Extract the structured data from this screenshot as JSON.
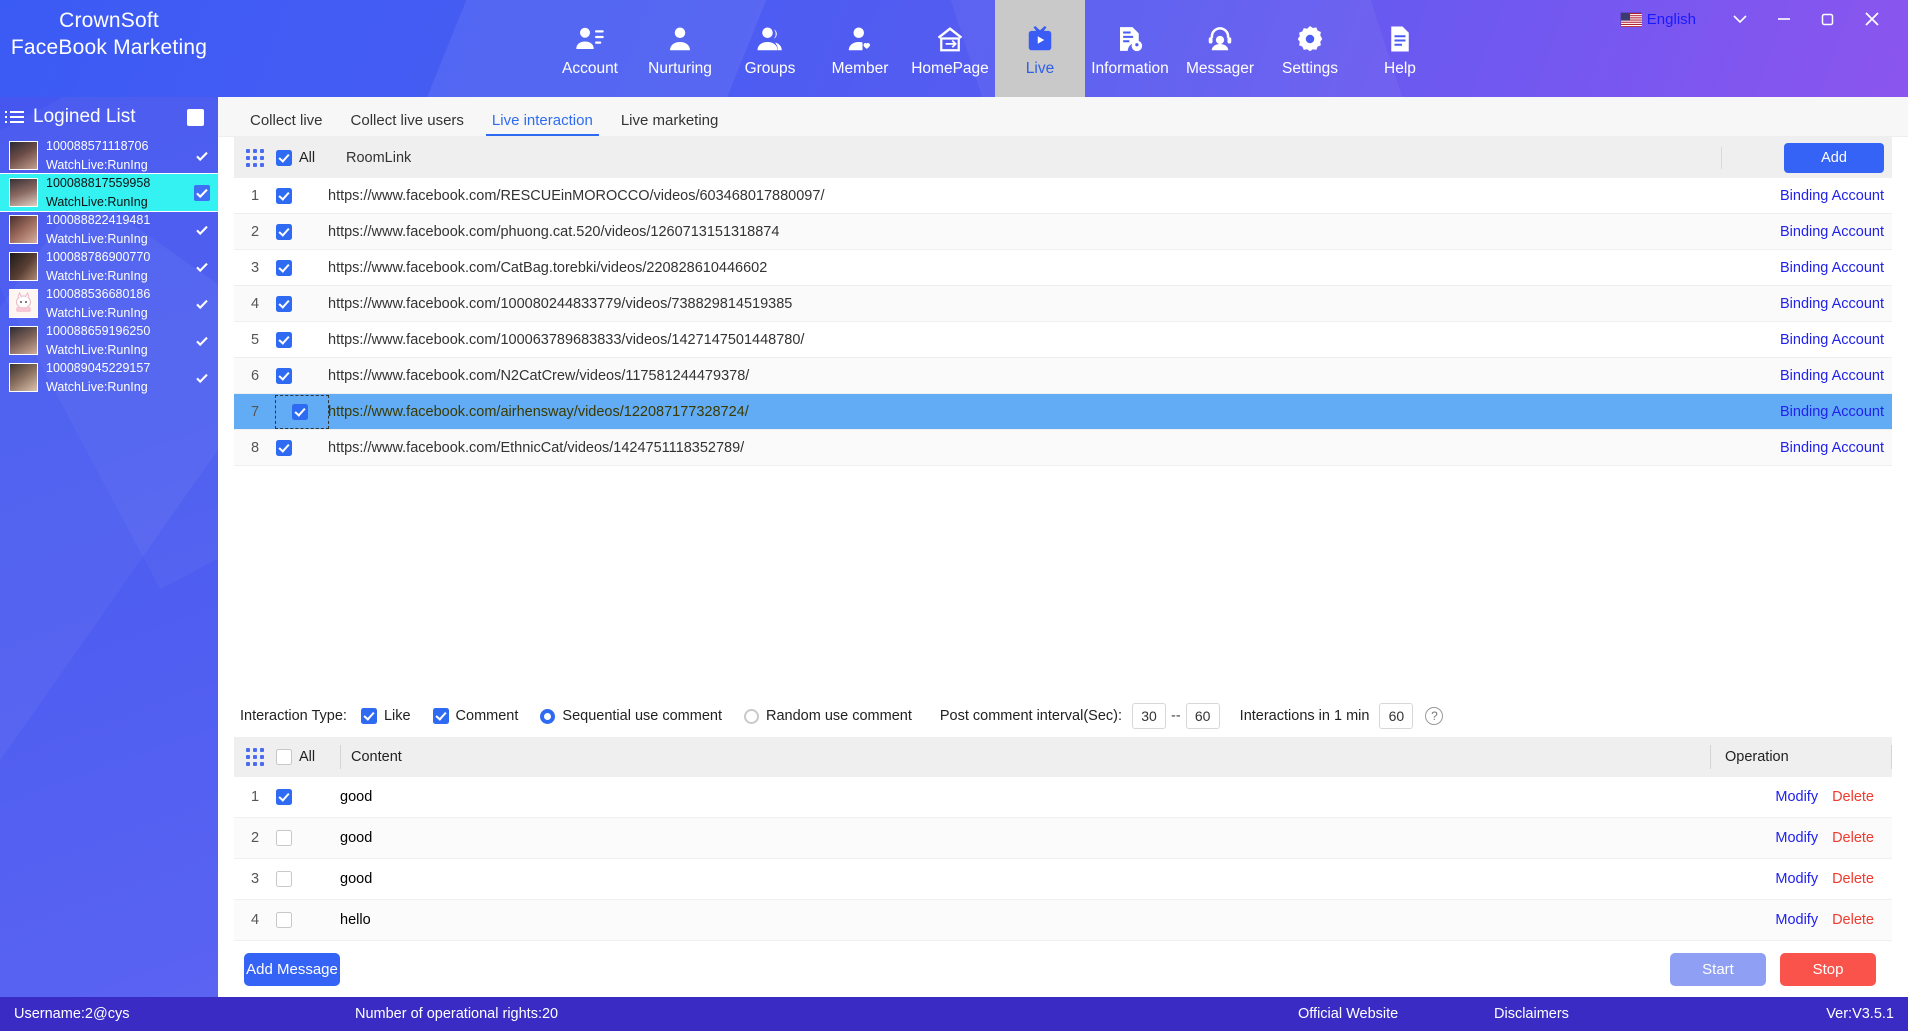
{
  "app": {
    "brand_line1": "CrownSoft",
    "brand_line2": "FaceBook Marketing"
  },
  "titlebar": {
    "language": "English",
    "flag_icon": "us-flag-icon",
    "chevron_icon": "chevron-down-icon",
    "minimize_icon": "minimize-icon",
    "maximize_icon": "maximize-icon",
    "close_icon": "close-icon"
  },
  "nav": {
    "items": [
      {
        "label": "Account",
        "icon": "account-icon",
        "active": false
      },
      {
        "label": "Nurturing",
        "icon": "nurturing-icon",
        "active": false
      },
      {
        "label": "Groups",
        "icon": "groups-icon",
        "active": false
      },
      {
        "label": "Member",
        "icon": "member-icon",
        "active": false
      },
      {
        "label": "HomePage",
        "icon": "homepage-icon",
        "active": false
      },
      {
        "label": "Live",
        "icon": "live-icon",
        "active": true
      },
      {
        "label": "Information",
        "icon": "information-icon",
        "active": false
      },
      {
        "label": "Messager",
        "icon": "messager-icon",
        "active": false
      },
      {
        "label": "Settings",
        "icon": "settings-icon",
        "active": false
      },
      {
        "label": "Help",
        "icon": "help-icon",
        "active": false
      }
    ]
  },
  "sidebar": {
    "title": "Logined List",
    "list_icon": "list-icon",
    "accounts": [
      {
        "id": "100088571118706",
        "status": "WatchLive:RunIng",
        "checked": true,
        "selected": false
      },
      {
        "id": "100088817559958",
        "status": "WatchLive:RunIng",
        "checked": true,
        "selected": true
      },
      {
        "id": "100088822419481",
        "status": "WatchLive:RunIng",
        "checked": true,
        "selected": false
      },
      {
        "id": "100088786900770",
        "status": "WatchLive:RunIng",
        "checked": true,
        "selected": false
      },
      {
        "id": "100088536680186",
        "status": "WatchLive:RunIng",
        "checked": true,
        "selected": false
      },
      {
        "id": "100088659196250",
        "status": "WatchLive:RunIng",
        "checked": true,
        "selected": false
      },
      {
        "id": "100089045229157",
        "status": "WatchLive:RunIng",
        "checked": true,
        "selected": false
      }
    ]
  },
  "tabs": [
    {
      "label": "Collect live",
      "active": false
    },
    {
      "label": "Collect live users",
      "active": false
    },
    {
      "label": "Live interaction",
      "active": true
    },
    {
      "label": "Live marketing",
      "active": false
    }
  ],
  "room_table": {
    "select_all_label": "All",
    "select_all_checked": true,
    "column_link": "RoomLink",
    "add_button": "Add",
    "action_label": "Binding Account",
    "rows": [
      {
        "index": "1",
        "checked": true,
        "link": "https://www.facebook.com/RESCUEinMOROCCO/videos/603468017880097/",
        "action": "Binding Account",
        "selected": false
      },
      {
        "index": "2",
        "checked": true,
        "link": "https://www.facebook.com/phuong.cat.520/videos/1260713151318874",
        "action": "Binding Account",
        "selected": false
      },
      {
        "index": "3",
        "checked": true,
        "link": "https://www.facebook.com/CatBag.torebki/videos/220828610446602",
        "action": "Binding Account",
        "selected": false
      },
      {
        "index": "4",
        "checked": true,
        "link": "https://www.facebook.com/100080244833779/videos/738829814519385",
        "action": "Binding Account",
        "selected": false
      },
      {
        "index": "5",
        "checked": true,
        "link": "https://www.facebook.com/100063789683833/videos/1427147501448780/",
        "action": "Binding Account",
        "selected": false
      },
      {
        "index": "6",
        "checked": true,
        "link": "https://www.facebook.com/N2CatCrew/videos/117581244479378/",
        "action": "Binding Account",
        "selected": false
      },
      {
        "index": "7",
        "checked": true,
        "link": "https://www.facebook.com/airhensway/videos/122087177328724/",
        "action": "Binding Account",
        "selected": true
      },
      {
        "index": "8",
        "checked": true,
        "link": "https://www.facebook.com/EthnicCat/videos/1424751118352789/",
        "action": "Binding Account",
        "selected": false
      }
    ]
  },
  "interaction": {
    "type_label": "Interaction Type:",
    "like_label": "Like",
    "like_checked": true,
    "comment_label": "Comment",
    "comment_checked": true,
    "sequential_label": "Sequential use comment",
    "sequential_selected": true,
    "random_label": "Random use comment",
    "random_selected": false,
    "interval_label": "Post comment interval(Sec):",
    "interval_min": "30",
    "interval_sep": "--",
    "interval_max": "60",
    "per_minute_label": "Interactions in 1 min",
    "per_minute_value": "60",
    "help_icon": "question-mark-icon",
    "help_glyph": "?"
  },
  "content_table": {
    "select_all_label": "All",
    "select_all_checked": false,
    "column_content": "Content",
    "column_operation": "Operation",
    "modify_label": "Modify",
    "delete_label": "Delete",
    "rows": [
      {
        "index": "1",
        "checked": true,
        "content": "good",
        "modify": "Modify",
        "delete": "Delete"
      },
      {
        "index": "2",
        "checked": false,
        "content": "good",
        "modify": "Modify",
        "delete": "Delete"
      },
      {
        "index": "3",
        "checked": false,
        "content": "good",
        "modify": "Modify",
        "delete": "Delete"
      },
      {
        "index": "4",
        "checked": false,
        "content": "hello",
        "modify": "Modify",
        "delete": "Delete"
      }
    ]
  },
  "footer_buttons": {
    "add_message": "Add Message",
    "start": "Start",
    "stop": "Stop"
  },
  "statusbar": {
    "username": "Username:2@cys",
    "rights": "Number of operational rights:20",
    "official_website": "Official Website",
    "disclaimers": "Disclaimers",
    "version": "Ver:V3.5.1"
  },
  "colors": {
    "brand_blue": "#3b5bf5",
    "accent_purple": "#8b55ef",
    "selected_row": "#62acf5",
    "selected_account": "#35f2f2",
    "status_bar": "#3a2bc4",
    "delete_red": "#f13a2e",
    "link_blue": "#2121ee",
    "stop_red": "#f9534c",
    "start_disabled": "#8e9ff4"
  }
}
